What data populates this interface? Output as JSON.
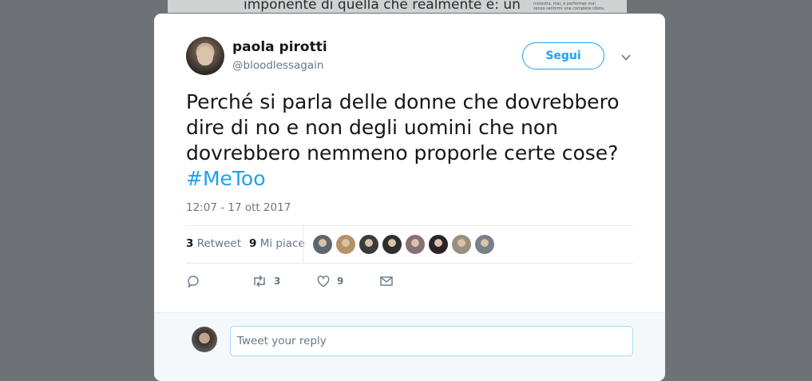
{
  "background": {
    "article_text": "imponente di quella che realmente è: un",
    "side_text": "molestia; mai, e performer mai senza sentirmi una completa idiota."
  },
  "tweet": {
    "author_name": "paola pirotti",
    "author_handle": "@bloodlessagain",
    "follow_label": "Segui",
    "text": "Perché si parla delle donne che dovrebbero\ndire di no e non degli uomini che non\ndovrebbero nemmeno proporle certe cose?",
    "hashtag": "#MeToo",
    "timestamp": "12:07 - 17 ott 2017",
    "retweet_count": "3",
    "retweet_label": "Retweet",
    "like_count": "9",
    "like_label": "Mi piace"
  },
  "actions": {
    "retweet_count": "3",
    "like_count": "9"
  },
  "reply": {
    "placeholder": "Tweet your reply"
  },
  "liker_avatars": [
    "#5d6770",
    "#b8906a",
    "#3b3b3b",
    "#2f2f2f",
    "#8a6f73",
    "#2b2428",
    "#9a8f7e",
    "#7a7f8a"
  ],
  "colors": {
    "accent": "#1da1f2",
    "text": "#14171a",
    "muted": "#657786"
  }
}
